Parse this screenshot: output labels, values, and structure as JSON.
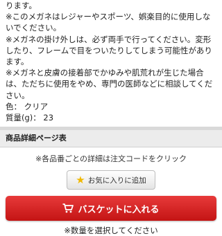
{
  "description": {
    "lines": [
      "ります。",
      "※このメガネはレジャーやスポーツ、娯楽目的に使用しないでください。",
      "※メガネの掛け外しは、必ず両手で行ってください。変形したり、フレームで目をついたりしてしまう可能性があります。",
      "※メガネと皮膚の接着部でかゆみや肌荒れが生じた場合は、ただちに使用をやめ、専門の医師などに相談してください。",
      "色： クリア",
      "質量(g)： 23"
    ]
  },
  "section": {
    "title": "商品詳細ページ表"
  },
  "detail_note": "※各品番ごとの詳細は注文コードをクリック",
  "favorite": {
    "label": "お気に入りに追加",
    "icon": "star-icon"
  },
  "basket": {
    "label": "バスケットに入れる",
    "icon": "cart-icon"
  },
  "quantity_warning": "※数量を選択してください",
  "colors": {
    "basket": "#d42020",
    "star": "#f0b800"
  }
}
